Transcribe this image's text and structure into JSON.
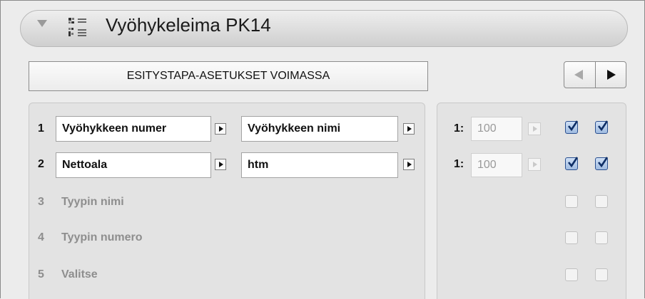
{
  "header": {
    "title": "Vyöhykeleima PK14",
    "collapse_icon": "disclosure-triangle-down-icon",
    "section_icon": "label-settings-icon"
  },
  "presentation": {
    "label": "ESITYSTAPA-ASETUKSET VOIMASSA"
  },
  "nav": {
    "prev_icon": "arrow-left-icon",
    "next_icon": "arrow-right-icon"
  },
  "rows": [
    {
      "num": "1",
      "field1": "Vyöhykkeen numer",
      "field2": "Vyöhykkeen nimi"
    },
    {
      "num": "2",
      "field1": "Nettoala",
      "field2": "htm"
    },
    {
      "num": "3",
      "label": "Tyypin nimi"
    },
    {
      "num": "4",
      "label": "Tyypin numero"
    },
    {
      "num": "5",
      "label": "Valitse"
    }
  ],
  "scales": [
    {
      "prefix": "1:",
      "value": "100",
      "check1": true,
      "check2": true
    },
    {
      "prefix": "1:",
      "value": "100",
      "check1": true,
      "check2": true
    },
    {
      "check1": false,
      "check2": false
    },
    {
      "check1": false,
      "check2": false
    },
    {
      "check1": false,
      "check2": false
    }
  ],
  "colors": {
    "accent": "#2a4f8f",
    "disabled_text": "#8e8e8e"
  }
}
